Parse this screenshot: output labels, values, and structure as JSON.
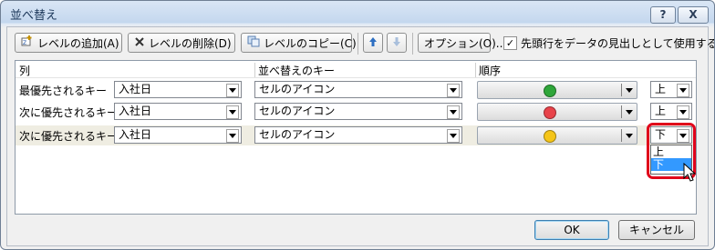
{
  "window": {
    "title": "並べ替え",
    "help_label": "?",
    "close_label": "X"
  },
  "toolbar": {
    "add_level": "レベルの追加(A)",
    "delete_level": "レベルの削除(D)",
    "copy_level": "レベルのコピー(C)",
    "options": "オプション(O)...",
    "header_checkbox_label": "先頭行をデータの見出しとして使用する(H)",
    "header_checked": true
  },
  "columns": {
    "col": "列",
    "sort_key": "並べ替えのキー",
    "order": "順序"
  },
  "rows": [
    {
      "label": "最優先されるキー",
      "column": "入社日",
      "sort_on": "セルのアイコン",
      "icon_color": "#2fa63a",
      "position": "上"
    },
    {
      "label": "次に優先されるキー",
      "column": "入社日",
      "sort_on": "セルのアイコン",
      "icon_color": "#e8434a",
      "position": "上"
    },
    {
      "label": "次に優先されるキー",
      "column": "入社日",
      "sort_on": "セルのアイコン",
      "icon_color": "#f5c518",
      "position": "下"
    }
  ],
  "position_options": [
    "上",
    "下"
  ],
  "highlighted_option": "下",
  "footer": {
    "ok": "OK",
    "cancel": "キャンセル"
  },
  "colors": {
    "accent_red": "#e0001a",
    "selection_blue": "#3399ff",
    "selected_row": "#efede2"
  }
}
